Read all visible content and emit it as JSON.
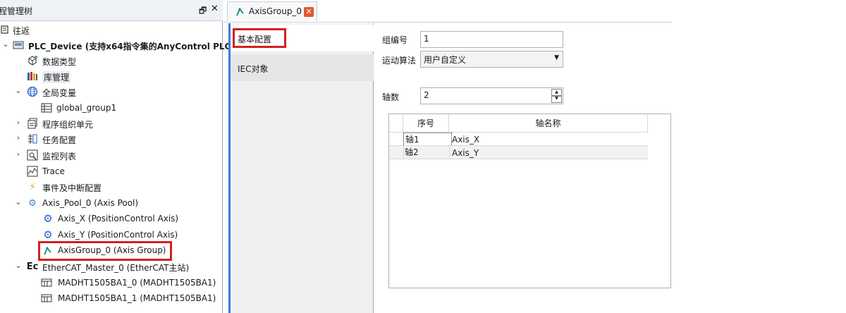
{
  "tree": {
    "title": "程管理树",
    "items": [
      {
        "label": "往返"
      },
      {
        "label": "PLC_Device (支持x64指令集的AnyControl PLC"
      },
      {
        "label": "数据类型"
      },
      {
        "label": "库管理"
      },
      {
        "label": "全局变量"
      },
      {
        "label": "global_group1"
      },
      {
        "label": "程序组织单元"
      },
      {
        "label": "任务配置"
      },
      {
        "label": "监视列表"
      },
      {
        "label": "Trace"
      },
      {
        "label": "事件及中断配置"
      },
      {
        "label": "Axis_Pool_0 (Axis Pool)"
      },
      {
        "label": "Axis_X (PositionControl Axis)"
      },
      {
        "label": "Axis_Y (PositionControl Axis)"
      },
      {
        "label": "AxisGroup_0 (Axis Group)"
      },
      {
        "label": "EtherCAT_Master_0 (EtherCAT主站)"
      },
      {
        "label": "MADHT1505BA1_0 (MADHT1505BA1)"
      },
      {
        "label": "MADHT1505BA1_1 (MADHT1505BA1)"
      }
    ]
  },
  "tab": {
    "label": "AxisGroup_0"
  },
  "nav": {
    "basic": "基本配置",
    "iec": "IEC对象"
  },
  "config": {
    "group_no_label": "组编号",
    "group_no_value": "1",
    "algo_label": "运动算法",
    "algo_value": "用户自定义",
    "axes_label": "轴数",
    "axes_value": "2"
  },
  "grid": {
    "headers": [
      "序号",
      "轴名称"
    ],
    "rows": [
      {
        "idx": "轴1",
        "name": "Axis_X"
      },
      {
        "idx": "轴2",
        "name": "Axis_Y"
      }
    ]
  },
  "colors": {
    "highlight": "#d42020",
    "accent": "#3b7fd6",
    "tab_close": "#e05a2c"
  }
}
